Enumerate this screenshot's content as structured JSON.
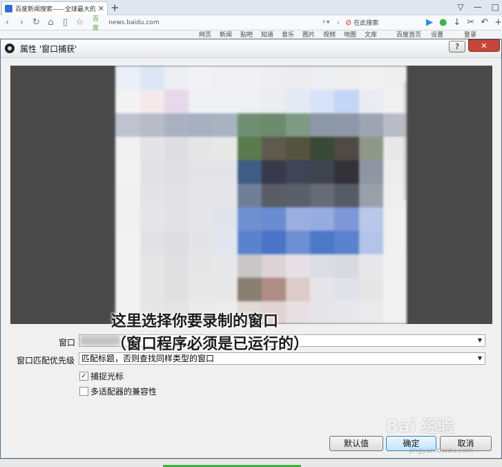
{
  "browser": {
    "tab_title": "百度新闻搜索——全球最大的中文新",
    "tab_close": "✕",
    "new_tab": "+",
    "url_badge": "百度",
    "url": "news.baidu.com",
    "search_placeholder": "在此搜索",
    "bookmarks": [
      "网页",
      "新闻",
      "贴吧",
      "知道",
      "音乐",
      "图片",
      "视频",
      "地图",
      "文库",
      "百度首页",
      "设置",
      "登录"
    ]
  },
  "dialog": {
    "title": "属性 '窗口捕获'",
    "help_label": "?",
    "close_label": "✕",
    "window_label": "窗口",
    "window_value": "",
    "match_priority_label": "窗口匹配优先级",
    "match_priority_value": "匹配标题，否则查找同样类型的窗口",
    "capture_cursor_label": "捕捉光标",
    "capture_cursor_checked": true,
    "multi_adapter_label": "多适配器的兼容性",
    "multi_adapter_checked": false,
    "defaults_button": "默认值",
    "ok_button": "确定",
    "cancel_button": "取消"
  },
  "annotation": {
    "line1": "这里选择你要录制的窗口",
    "line2": "（窗口程序必须是已运行的）"
  },
  "watermark": {
    "brand": "Bai 经验",
    "url": "jingyan.baidu.com"
  },
  "icons": {
    "app": "obs-icon",
    "checkmark": "✓"
  }
}
